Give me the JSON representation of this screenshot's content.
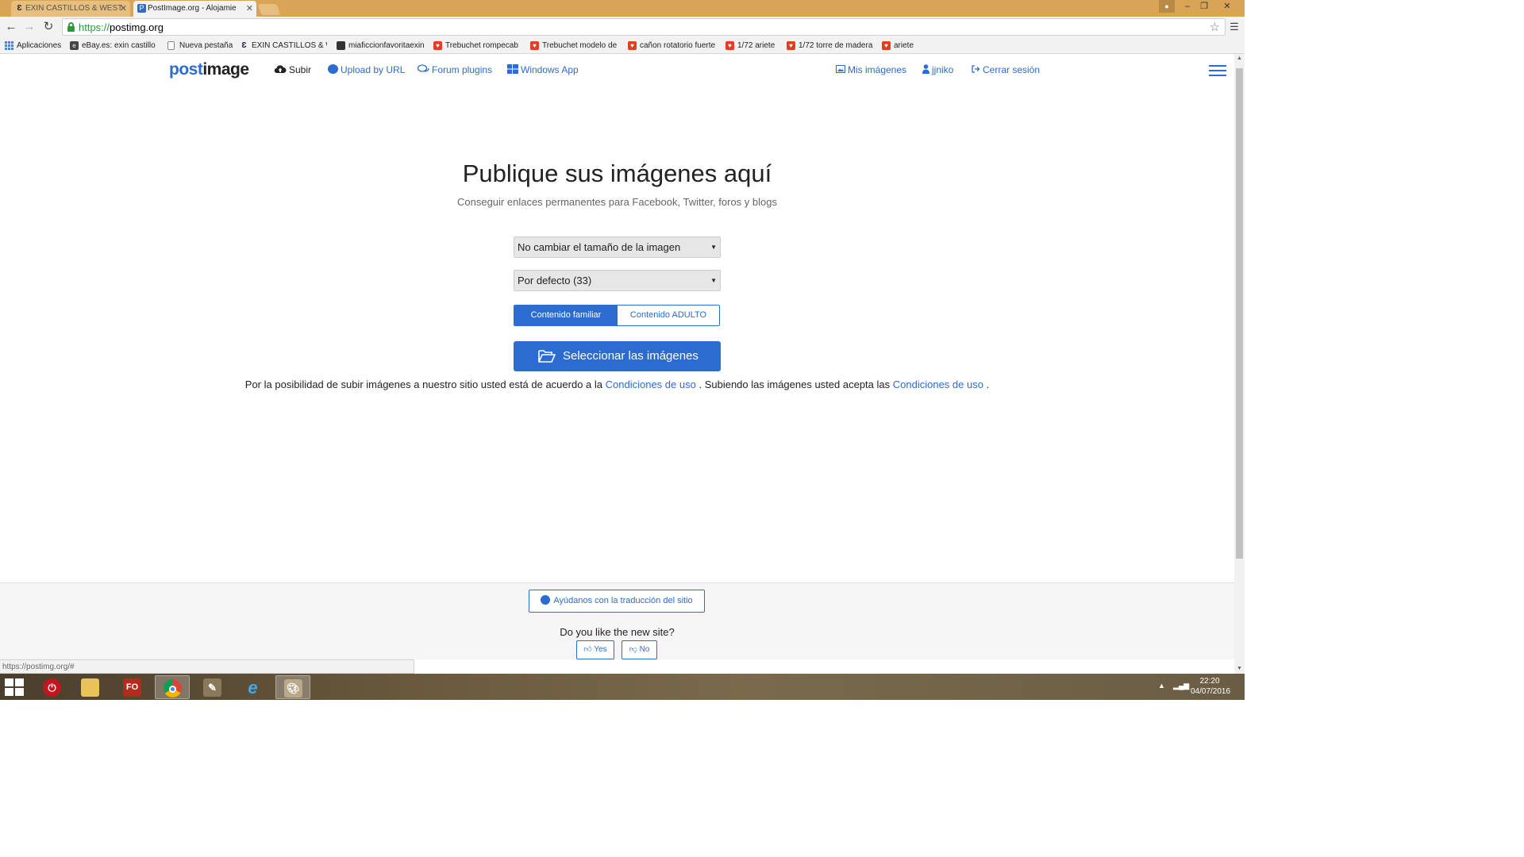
{
  "browser": {
    "tabs": [
      {
        "title": "EXIN CASTILLOS & WEST",
        "active": false
      },
      {
        "title": "PostImage.org - Alojamie",
        "active": true
      }
    ],
    "window_controls": {
      "minimize": "–",
      "restore": "❐",
      "close": "✕"
    },
    "url_scheme": "https://",
    "url_host": "postimg.org",
    "status_url": "https://postimg.org/#"
  },
  "bookmarks": [
    {
      "label": "Aplicaciones",
      "icon": "apps-grid-icon"
    },
    {
      "label": "eBay.es: exin castillos",
      "icon": "ebay-icon"
    },
    {
      "label": "Nueva pestaña",
      "icon": "page-icon"
    },
    {
      "label": "EXIN CASTILLOS & W",
      "icon": "exin-icon"
    },
    {
      "label": "miaficcionfavoritaexin",
      "icon": "blog-icon"
    },
    {
      "label": "Trebuchet rompecab",
      "icon": "store-icon"
    },
    {
      "label": "Trebuchet modelo de",
      "icon": "store-icon"
    },
    {
      "label": "cañon rotatorio fuerte",
      "icon": "store-icon"
    },
    {
      "label": "1/72 ariete",
      "icon": "store-icon"
    },
    {
      "label": "1/72 torre de madera",
      "icon": "store-icon"
    },
    {
      "label": "ariete",
      "icon": "store-icon"
    }
  ],
  "site": {
    "logo_part1": "post",
    "logo_part2": "image",
    "nav": {
      "upload": "Subir",
      "upload_url": "Upload by URL",
      "forum_plugins": "Forum plugins",
      "windows_app": "Windows App",
      "my_images": "Mis imágenes",
      "user": "jjniko",
      "logout": "Cerrar sesión"
    },
    "hero": {
      "title": "Publique sus imágenes aquí",
      "subtitle": "Conseguir enlaces permanentes para Facebook, Twitter, foros y blogs"
    },
    "resize_select": {
      "value": "No cambiar el tamaño de la imagen"
    },
    "gallery_select": {
      "value": "Por defecto (33)"
    },
    "content_toggle": {
      "family": "Contenido familiar",
      "adult": "Contenido ADULTO",
      "selected": "family"
    },
    "select_images_button": "Seleccionar las imágenes",
    "terms": {
      "text1": "Por la posibilidad de subir imágenes a nuestro sitio usted está de acuerdo a la",
      "link1": "Condiciones de uso",
      "text2": ". Subiendo las imágenes usted acepta las",
      "link2": "Condiciones de uso",
      "text3": "."
    },
    "footer": {
      "translate_button": "Ayúdanos con la traducción del sitio",
      "like_question": "Do you like the new site?",
      "yes": "Yes",
      "no": "No"
    }
  },
  "taskbar": {
    "time": "22:20",
    "date": "04/07/2016"
  },
  "colors": {
    "accent": "#2c6cd1",
    "tabstrip": "#d9a456"
  }
}
